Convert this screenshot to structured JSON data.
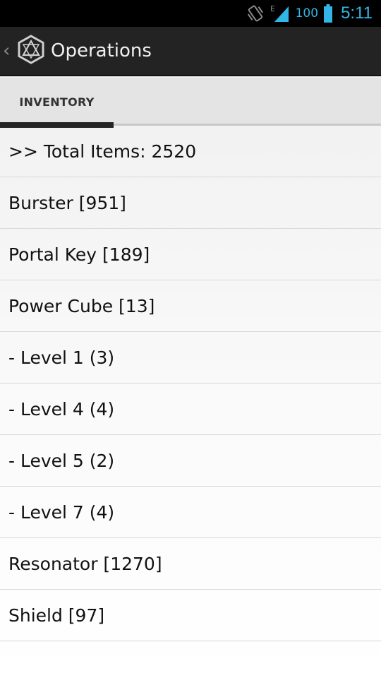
{
  "status_bar": {
    "network_type": "E",
    "battery_level": "100",
    "time": "5:11",
    "icons": [
      "vibrate-icon",
      "signal-icon",
      "battery-icon"
    ],
    "accent_color": "#33b5e5"
  },
  "action_bar": {
    "title": "Operations",
    "up_icon": "chevron-left-icon",
    "logo_icon": "app-logo-icon"
  },
  "tabs": [
    {
      "label": "INVENTORY",
      "selected": true
    }
  ],
  "inventory": {
    "items": [
      {
        "label": ">> Total Items: 2520"
      },
      {
        "label": "Burster [951]"
      },
      {
        "label": "Portal Key [189]"
      },
      {
        "label": "Power Cube [13]"
      },
      {
        "label": "- Level 1 (3)"
      },
      {
        "label": "- Level 4 (4)"
      },
      {
        "label": "- Level 5 (2)"
      },
      {
        "label": "- Level 7 (4)"
      },
      {
        "label": "Resonator [1270]"
      },
      {
        "label": "Shield [97]"
      }
    ]
  }
}
